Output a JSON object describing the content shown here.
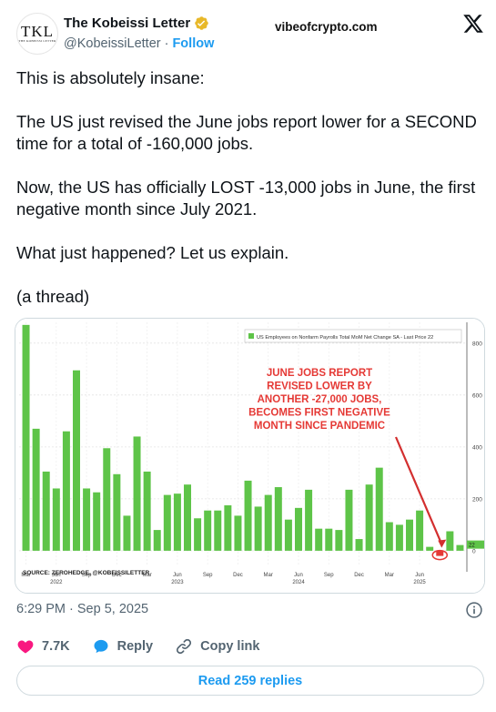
{
  "author": {
    "name": "The Kobeissi Letter",
    "handle": "@KobeissiLetter",
    "follow_label": "Follow",
    "avatar_monogram": "TKL",
    "avatar_caption": "THE KOBEISSI LETTER"
  },
  "watermark": "vibeofcrypto.com",
  "tweet": {
    "paragraphs": [
      "This is absolutely insane:",
      "The US just revised the June jobs report lower for a SECOND time for a total of -160,000 jobs.",
      "Now, the US has officially LOST -13,000 jobs in June, the first negative month since July 2021.",
      "What just happened? Let us explain.",
      "(a thread)"
    ]
  },
  "chart_data": {
    "type": "bar",
    "legend": "US Employees on Nonfarm Payrolls Total MoM Net Change SA - Last Price",
    "legend_value": "22",
    "annotation": [
      "JUNE JOBS REPORT",
      "REVISED LOWER BY",
      "ANOTHER -27,000 JOBS,",
      "BECOMES FIRST NEGATIVE",
      "MONTH SINCE PANDEMIC"
    ],
    "source": "SOURCE: ZEROHEDGE, @KOBEISSILETTER",
    "ylim": [
      -60,
      880
    ],
    "yticks": [
      0,
      200,
      400,
      600,
      800
    ],
    "last_price_label": "22",
    "x_tick_labels": [
      {
        "label": "Mar",
        "year": ""
      },
      {
        "label": "Jun",
        "year": "2022"
      },
      {
        "label": "Sep",
        "year": ""
      },
      {
        "label": "Dec",
        "year": ""
      },
      {
        "label": "Mar",
        "year": ""
      },
      {
        "label": "Jun",
        "year": "2023"
      },
      {
        "label": "Sep",
        "year": ""
      },
      {
        "label": "Dec",
        "year": ""
      },
      {
        "label": "Mar",
        "year": ""
      },
      {
        "label": "Jun",
        "year": "2024"
      },
      {
        "label": "Sep",
        "year": ""
      },
      {
        "label": "Dec",
        "year": ""
      },
      {
        "label": "Mar",
        "year": ""
      },
      {
        "label": "Jun",
        "year": "2025"
      }
    ],
    "values": [
      870,
      470,
      305,
      240,
      460,
      695,
      240,
      225,
      395,
      295,
      135,
      440,
      305,
      80,
      215,
      220,
      255,
      125,
      155,
      155,
      175,
      135,
      270,
      170,
      215,
      245,
      120,
      165,
      235,
      85,
      85,
      80,
      235,
      45,
      255,
      320,
      110,
      100,
      120,
      155,
      15,
      -20,
      75,
      22
    ],
    "highlight_index": 41
  },
  "footer": {
    "time": "6:29 PM",
    "date": "Sep 5, 2025",
    "likes": "7.7K",
    "reply_label": "Reply",
    "copy_link_label": "Copy link",
    "read_replies_label": "Read 259 replies"
  },
  "colors": {
    "accent": "#1d9bf0",
    "bar": "#5ec448",
    "annotation": "#e53935",
    "like": "#f91880"
  }
}
